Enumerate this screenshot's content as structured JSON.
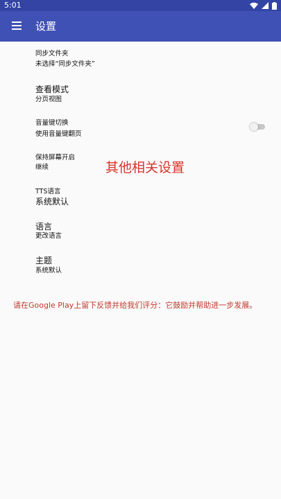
{
  "status_bar": {
    "time": "5:01",
    "icons": [
      "wifi-icon",
      "signal-icon",
      "battery-icon"
    ]
  },
  "app_bar": {
    "title": "设置",
    "menu_icon": "menu-icon",
    "color": "#3f51b5"
  },
  "settings": [
    {
      "title": "同步文件夹",
      "subtitle": "未选择“同步文件夹”"
    },
    {
      "title": "查看模式",
      "subtitle": "分页视图"
    },
    {
      "title": "音量键切换",
      "subtitle": "使用音量键翻页",
      "toggle": false
    },
    {
      "title": "保持屏幕开启",
      "subtitle": "继续"
    },
    {
      "title": "TTS语言",
      "subtitle": "系统默认"
    },
    {
      "title": "语言",
      "subtitle": "更改语言"
    },
    {
      "title": "主题",
      "subtitle": "系统默认"
    }
  ],
  "overlay_text": "其他相关设置",
  "feedback_text": "请在Google Play上留下反馈并给我们评分：它鼓励并帮助进一步发展。",
  "colors": {
    "status_bar": "#3344a5",
    "accent_red": "#d9342a"
  }
}
